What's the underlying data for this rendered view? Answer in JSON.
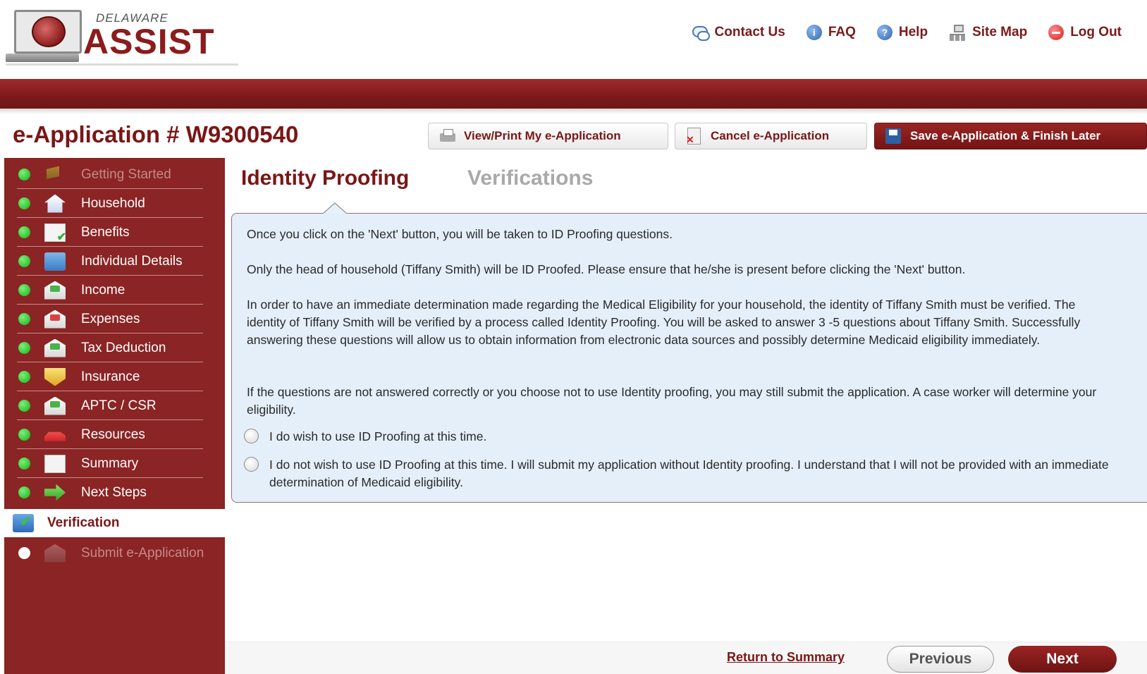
{
  "logo": {
    "state": "DELAWARE",
    "name": "ASSIST"
  },
  "topnav": [
    {
      "label": "Contact Us",
      "icon": "contact-icon"
    },
    {
      "label": "FAQ",
      "icon": "info-icon"
    },
    {
      "label": "Help",
      "icon": "help-icon"
    },
    {
      "label": "Site Map",
      "icon": "sitemap-icon"
    },
    {
      "label": "Log Out",
      "icon": "logout-icon"
    }
  ],
  "app": {
    "title": "e-Application # W9300540"
  },
  "toolbar": {
    "view_print": "View/Print My e-Application",
    "cancel": "Cancel e-Application",
    "save": "Save e-Application & Finish Later"
  },
  "sidebar": {
    "items": [
      {
        "label": "Getting Started",
        "icon": "flag-icon",
        "state": "disabled"
      },
      {
        "label": "Household",
        "icon": "house-icon",
        "state": "complete"
      },
      {
        "label": "Benefits",
        "icon": "benefits-doc-icon",
        "state": "complete"
      },
      {
        "label": "Individual Details",
        "icon": "id-card-icon",
        "state": "complete"
      },
      {
        "label": "Income",
        "icon": "income-envelope-icon",
        "state": "complete"
      },
      {
        "label": "Expenses",
        "icon": "expenses-envelope-icon",
        "state": "complete"
      },
      {
        "label": "Tax Deduction",
        "icon": "tax-envelope-icon",
        "state": "complete"
      },
      {
        "label": "Insurance",
        "icon": "insurance-shield-icon",
        "state": "complete"
      },
      {
        "label": "APTC / CSR",
        "icon": "aptc-envelope-icon",
        "state": "complete"
      },
      {
        "label": "Resources",
        "icon": "car-icon",
        "state": "complete"
      },
      {
        "label": "Summary",
        "icon": "summary-doc-icon",
        "state": "complete"
      },
      {
        "label": "Next Steps",
        "icon": "arrow-right-icon",
        "state": "complete"
      },
      {
        "label": "Verification",
        "icon": "verification-icon",
        "state": "active"
      },
      {
        "label": "Submit e-Application",
        "icon": "submit-envelope-icon",
        "state": "disabled"
      }
    ]
  },
  "tabs": {
    "active": "Identity Proofing",
    "inactive": "Verifications"
  },
  "content": {
    "p1": "Once you click on the 'Next' button, you will be taken to ID Proofing questions.",
    "p2": "Only the head of household (Tiffany Smith) will be ID Proofed. Please ensure that he/she is present before clicking the 'Next' button.",
    "p3": "In order to have an immediate determination made regarding the Medical Eligibility for your household, the identity of Tiffany Smith must be verified. The identity of Tiffany Smith will be verified by a process called Identity Proofing. You will be asked to answer 3 -5 questions about Tiffany Smith. Successfully answering these questions will allow us to obtain information from electronic data sources and possibly determine Medicaid eligibility immediately.",
    "p4": "If the questions are not answered correctly or you choose not to use Identity proofing, you may still submit the application. A case worker will determine your eligibility.",
    "option_yes": "I do wish to use ID Proofing at this time.",
    "option_no": "I do not wish to use ID Proofing at this time. I will submit my application without Identity proofing. I understand that I will not be provided with an immediate determination of Medicaid eligibility."
  },
  "footer": {
    "return": "Return to Summary",
    "previous": "Previous",
    "next": "Next"
  },
  "colors": {
    "brand": "#8b1c1c",
    "sidebar": "#8b2424",
    "content_bg": "#e4effa",
    "complete_dot": "#12b312"
  }
}
